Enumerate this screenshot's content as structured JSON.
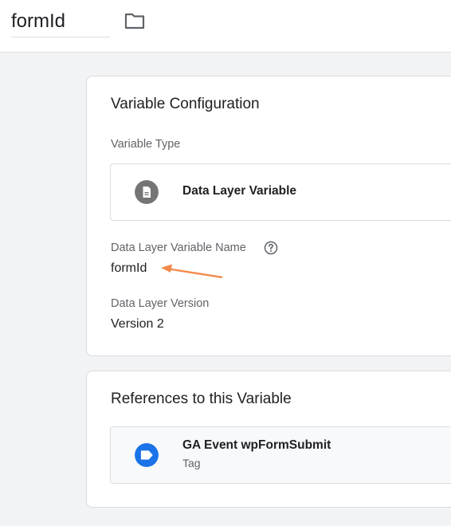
{
  "header": {
    "variable_name": "formId",
    "folder_icon": "folder-icon"
  },
  "config": {
    "title": "Variable Configuration",
    "type_label": "Variable Type",
    "type_value": "Data Layer Variable",
    "type_icon": "document-icon",
    "name_label": "Data Layer Variable Name",
    "name_value": "formId",
    "help_icon": "help-icon",
    "version_label": "Data Layer Version",
    "version_value": "Version 2"
  },
  "references": {
    "title": "References to this Variable",
    "items": [
      {
        "name": "GA Event wpFormSubmit",
        "kind": "Tag",
        "icon": "tag-icon"
      }
    ]
  },
  "colors": {
    "accent_blue": "#1a73e8",
    "icon_gray": "#757575",
    "annotation_arrow": "#f28a4b"
  }
}
